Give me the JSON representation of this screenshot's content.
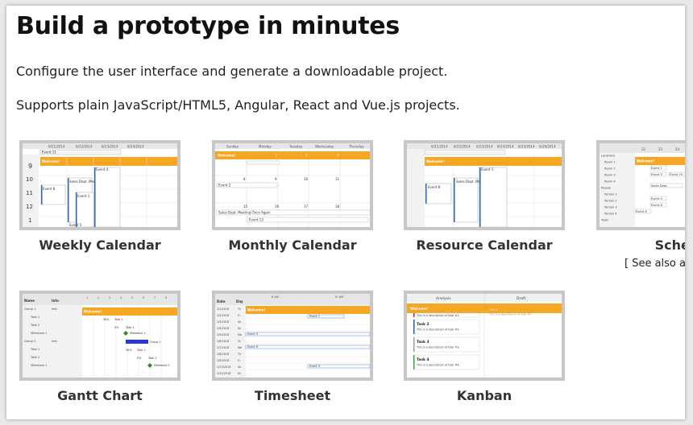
{
  "heading": "Build a prototype in minutes",
  "paragraphs": [
    "Configure the user interface and generate a downloadable project.",
    "Supports plain JavaScript/HTML5, Angular, React and Vue.js projects."
  ],
  "see_also": "[ See also a",
  "tiles": [
    {
      "title": "Weekly Calendar"
    },
    {
      "title": "Monthly Calendar"
    },
    {
      "title": "Resource Calendar"
    },
    {
      "title": "Sched"
    },
    {
      "title": "Gantt Chart"
    },
    {
      "title": "Timesheet"
    },
    {
      "title": "Kanban"
    }
  ],
  "thumbs": {
    "weekly": {
      "dates": [
        "6/21/2014",
        "6/22/2014",
        "6/23/2014",
        "6/24/2014"
      ],
      "hours": [
        "9",
        "10",
        "11",
        "12",
        "1"
      ],
      "banner": "Welcome!",
      "events": [
        "Event 11",
        "Sales Dept. Meeting",
        "Event 8",
        "Event 1",
        "Event 4",
        "Event 5"
      ]
    },
    "monthly": {
      "days": [
        "Sunday",
        "Monday",
        "Tuesday",
        "Wednesday",
        "Thursday"
      ],
      "banner": "Welcome!",
      "nums": [
        "1",
        "2",
        "3",
        "8",
        "9",
        "10",
        "11",
        "15",
        "16",
        "17",
        "18"
      ],
      "events": [
        "Event 2",
        "Sales Dept. Meeting Once Again",
        "Event 13"
      ]
    },
    "resource": {
      "dates": [
        "6/21/2014",
        "6/22/2014",
        "6/23/2014",
        "6/24/2014",
        "6/25/2014",
        "6/26/2014"
      ],
      "banner": "Welcome!",
      "events": [
        "Event 8",
        "Sales Dept. Meeting",
        "Event 1"
      ]
    },
    "scheduler": {
      "cols": [
        "22",
        "23",
        "24"
      ],
      "rows": [
        "Locations",
        "Room 1",
        "Room 2",
        "Room 3",
        "Room 4",
        "People",
        "Person 1",
        "Person 2",
        "Person 3",
        "Person 4",
        "Tools"
      ],
      "banner": "Welcome!",
      "events": [
        "Event 1",
        "Event 3",
        "Event 10",
        "Sales Dept.",
        "Event 4",
        "Event 6",
        "Event 8"
      ]
    },
    "gantt": {
      "headers": [
        "Name",
        "Info"
      ],
      "days": [
        "1",
        "2",
        "3",
        "4",
        "5",
        "6",
        "7",
        "8"
      ],
      "rows": [
        {
          "name": "Group 1",
          "info": "info"
        },
        {
          "name": "Task 1",
          "info": ""
        },
        {
          "name": "Task 2",
          "info": ""
        },
        {
          "name": "Milestone 1",
          "info": ""
        },
        {
          "name": "Group 2",
          "info": "info"
        },
        {
          "name": "Task 1",
          "info": ""
        },
        {
          "name": "Task 2",
          "info": ""
        },
        {
          "name": "Milestone 1",
          "info": ""
        }
      ],
      "banner": "Welcome!",
      "labels": [
        "30%",
        "Task 1",
        "0%",
        "Task 2",
        "Milestone 1",
        "Group 2",
        "30%",
        "Task 1",
        "0%",
        "Task 2",
        "Milestone 2"
      ]
    },
    "timesheet": {
      "header": [
        "Date",
        "Day"
      ],
      "periods": [
        "8 AM",
        "10 AM"
      ],
      "rows": [
        {
          "date": "2/1/2018",
          "day": "Th"
        },
        {
          "date": "2/2/2018",
          "day": "Fr"
        },
        {
          "date": "2/3/2018",
          "day": "Sa"
        },
        {
          "date": "2/4/2018",
          "day": "Su"
        },
        {
          "date": "2/5/2018",
          "day": "Mo"
        },
        {
          "date": "2/6/2018",
          "day": "Tu"
        },
        {
          "date": "2/7/2018",
          "day": "We"
        },
        {
          "date": "2/8/2018",
          "day": "Th"
        },
        {
          "date": "2/9/2018",
          "day": "Fr"
        },
        {
          "date": "2/10/2018",
          "day": "Sa"
        },
        {
          "date": "2/11/2018",
          "day": "Su"
        }
      ],
      "banner": "Welcome!",
      "events": [
        "Event 1",
        "Event 4",
        "Event 6",
        "Event 9"
      ]
    },
    "kanban": {
      "columns": [
        "Analysis",
        "Draft"
      ],
      "banner": "Welcome!",
      "cards": [
        {
          "title": "",
          "desc": "This is a description of task #1."
        },
        {
          "title": "Task 2",
          "desc": "This is a description of task #2."
        },
        {
          "title": "Task 3",
          "desc": "This is a description of task #3."
        },
        {
          "title": "Task 4",
          "desc": "This is a description of task #4."
        }
      ],
      "draft_cards": [
        {
          "title": "Task 5",
          "desc": "This is a description of task #5."
        }
      ]
    }
  }
}
